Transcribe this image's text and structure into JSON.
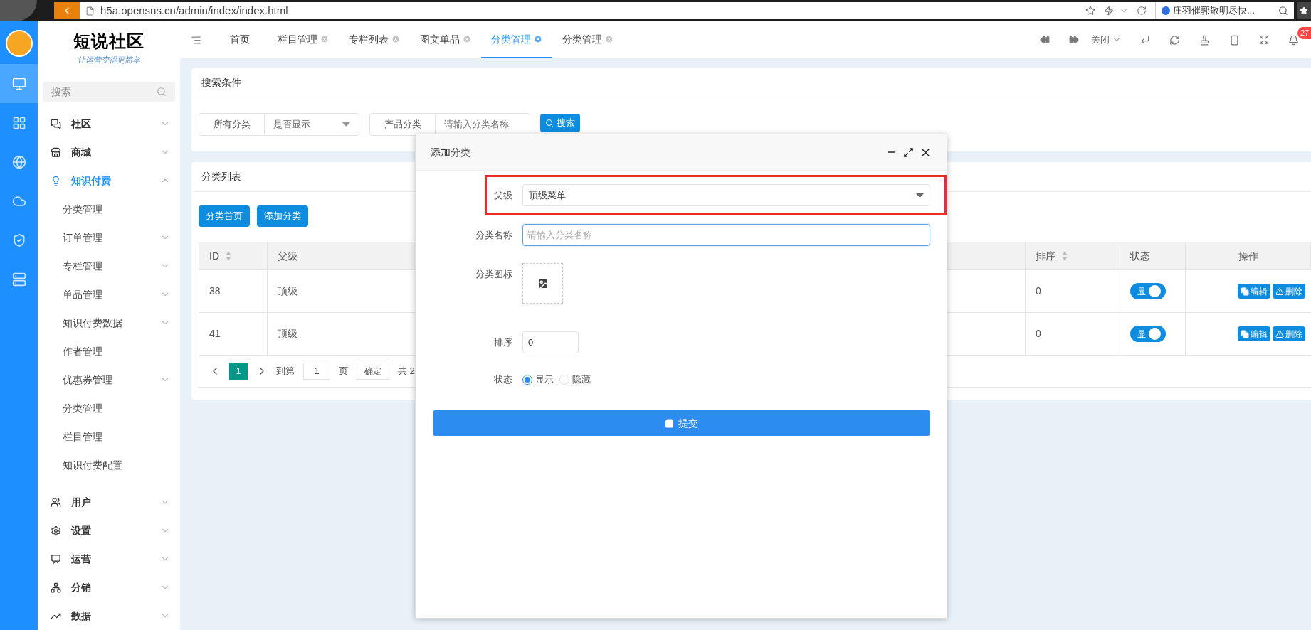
{
  "browser": {
    "url": "h5a.opensns.cn/admin/index/index.html",
    "search": "庄羽催郭敬明尽快..."
  },
  "rail": [
    {
      "selected": true
    },
    {
      "selected": false
    },
    {
      "selected": false
    },
    {
      "selected": false
    },
    {
      "selected": false
    },
    {
      "selected": false
    }
  ],
  "logo": {
    "title": "短说社区",
    "slogan": "让运营变得更简单"
  },
  "sidebar": {
    "search_placeholder": "搜索",
    "items": [
      {
        "label": "社区",
        "expanded": false,
        "selected": false
      },
      {
        "label": "商城",
        "expanded": false,
        "selected": false
      },
      {
        "label": "知识付费",
        "expanded": true,
        "selected": true,
        "children": [
          {
            "label": "分类管理",
            "has_submenu": false
          },
          {
            "label": "订单管理",
            "has_submenu": true
          },
          {
            "label": "专栏管理",
            "has_submenu": true
          },
          {
            "label": "单品管理",
            "has_submenu": true
          },
          {
            "label": "知识付费数据",
            "has_submenu": true
          },
          {
            "label": "作者管理",
            "has_submenu": false
          },
          {
            "label": "优惠券管理",
            "has_submenu": true
          },
          {
            "label": "分类管理",
            "has_submenu": false
          },
          {
            "label": "栏目管理",
            "has_submenu": false
          },
          {
            "label": "知识付费配置",
            "has_submenu": false
          }
        ]
      },
      {
        "label": "用户",
        "expanded": false,
        "selected": false
      },
      {
        "label": "设置",
        "expanded": false,
        "selected": false
      },
      {
        "label": "运营",
        "expanded": false,
        "selected": false
      },
      {
        "label": "分销",
        "expanded": false,
        "selected": false
      },
      {
        "label": "数据",
        "expanded": false,
        "selected": false
      }
    ]
  },
  "tabs": [
    {
      "label": "首页",
      "closable": false,
      "selected": false
    },
    {
      "label": "栏目管理",
      "closable": true,
      "selected": false
    },
    {
      "label": "专栏列表",
      "closable": true,
      "selected": false
    },
    {
      "label": "图文单品",
      "closable": true,
      "selected": false
    },
    {
      "label": "分类管理",
      "closable": true,
      "selected": true
    },
    {
      "label": "分类管理",
      "closable": true,
      "selected": false
    }
  ],
  "toolbar": {
    "close_menu": "关闭",
    "notifications": "27"
  },
  "search_card": {
    "title": "搜索条件",
    "filter_1": {
      "label": "所有分类",
      "value": "是否显示"
    },
    "filter_2": {
      "label": "产品分类",
      "placeholder": "请输入分类名称"
    },
    "button": "搜索"
  },
  "list_card": {
    "title": "分类列表",
    "buttons": [
      "分类首页",
      "添加分类"
    ],
    "columns": [
      {
        "label": "ID",
        "sortable": true
      },
      {
        "label": "父级",
        "sortable": false
      },
      {
        "label": "排序",
        "sortable": true
      },
      {
        "label": "状态",
        "sortable": false
      },
      {
        "label": "操作",
        "sortable": false
      }
    ],
    "rows": [
      {
        "id": "38",
        "parent": "顶级",
        "sort": "0",
        "status": "显",
        "status_on": true,
        "actions": [
          "编辑",
          "删除"
        ]
      },
      {
        "id": "41",
        "parent": "顶级",
        "sort": "0",
        "status": "显",
        "status_on": true,
        "actions": [
          "编辑",
          "删除"
        ]
      }
    ],
    "pagination": {
      "current": "1",
      "goto_label": "到第",
      "goto_value": "1",
      "page_unit": "页",
      "confirm": "确定",
      "total": "共 2"
    }
  },
  "dialog": {
    "title": "添加分类",
    "parent": {
      "label": "父级",
      "value": "顶级菜单",
      "highlighted": true
    },
    "name": {
      "label": "分类名称",
      "placeholder": "请输入分类名称",
      "focused": true
    },
    "icon": {
      "label": "分类图标"
    },
    "sort": {
      "label": "排序",
      "value": "0"
    },
    "status": {
      "label": "状态",
      "options": [
        {
          "label": "显示",
          "selected": true
        },
        {
          "label": "隐藏",
          "selected": false
        }
      ]
    },
    "submit": "提交"
  }
}
